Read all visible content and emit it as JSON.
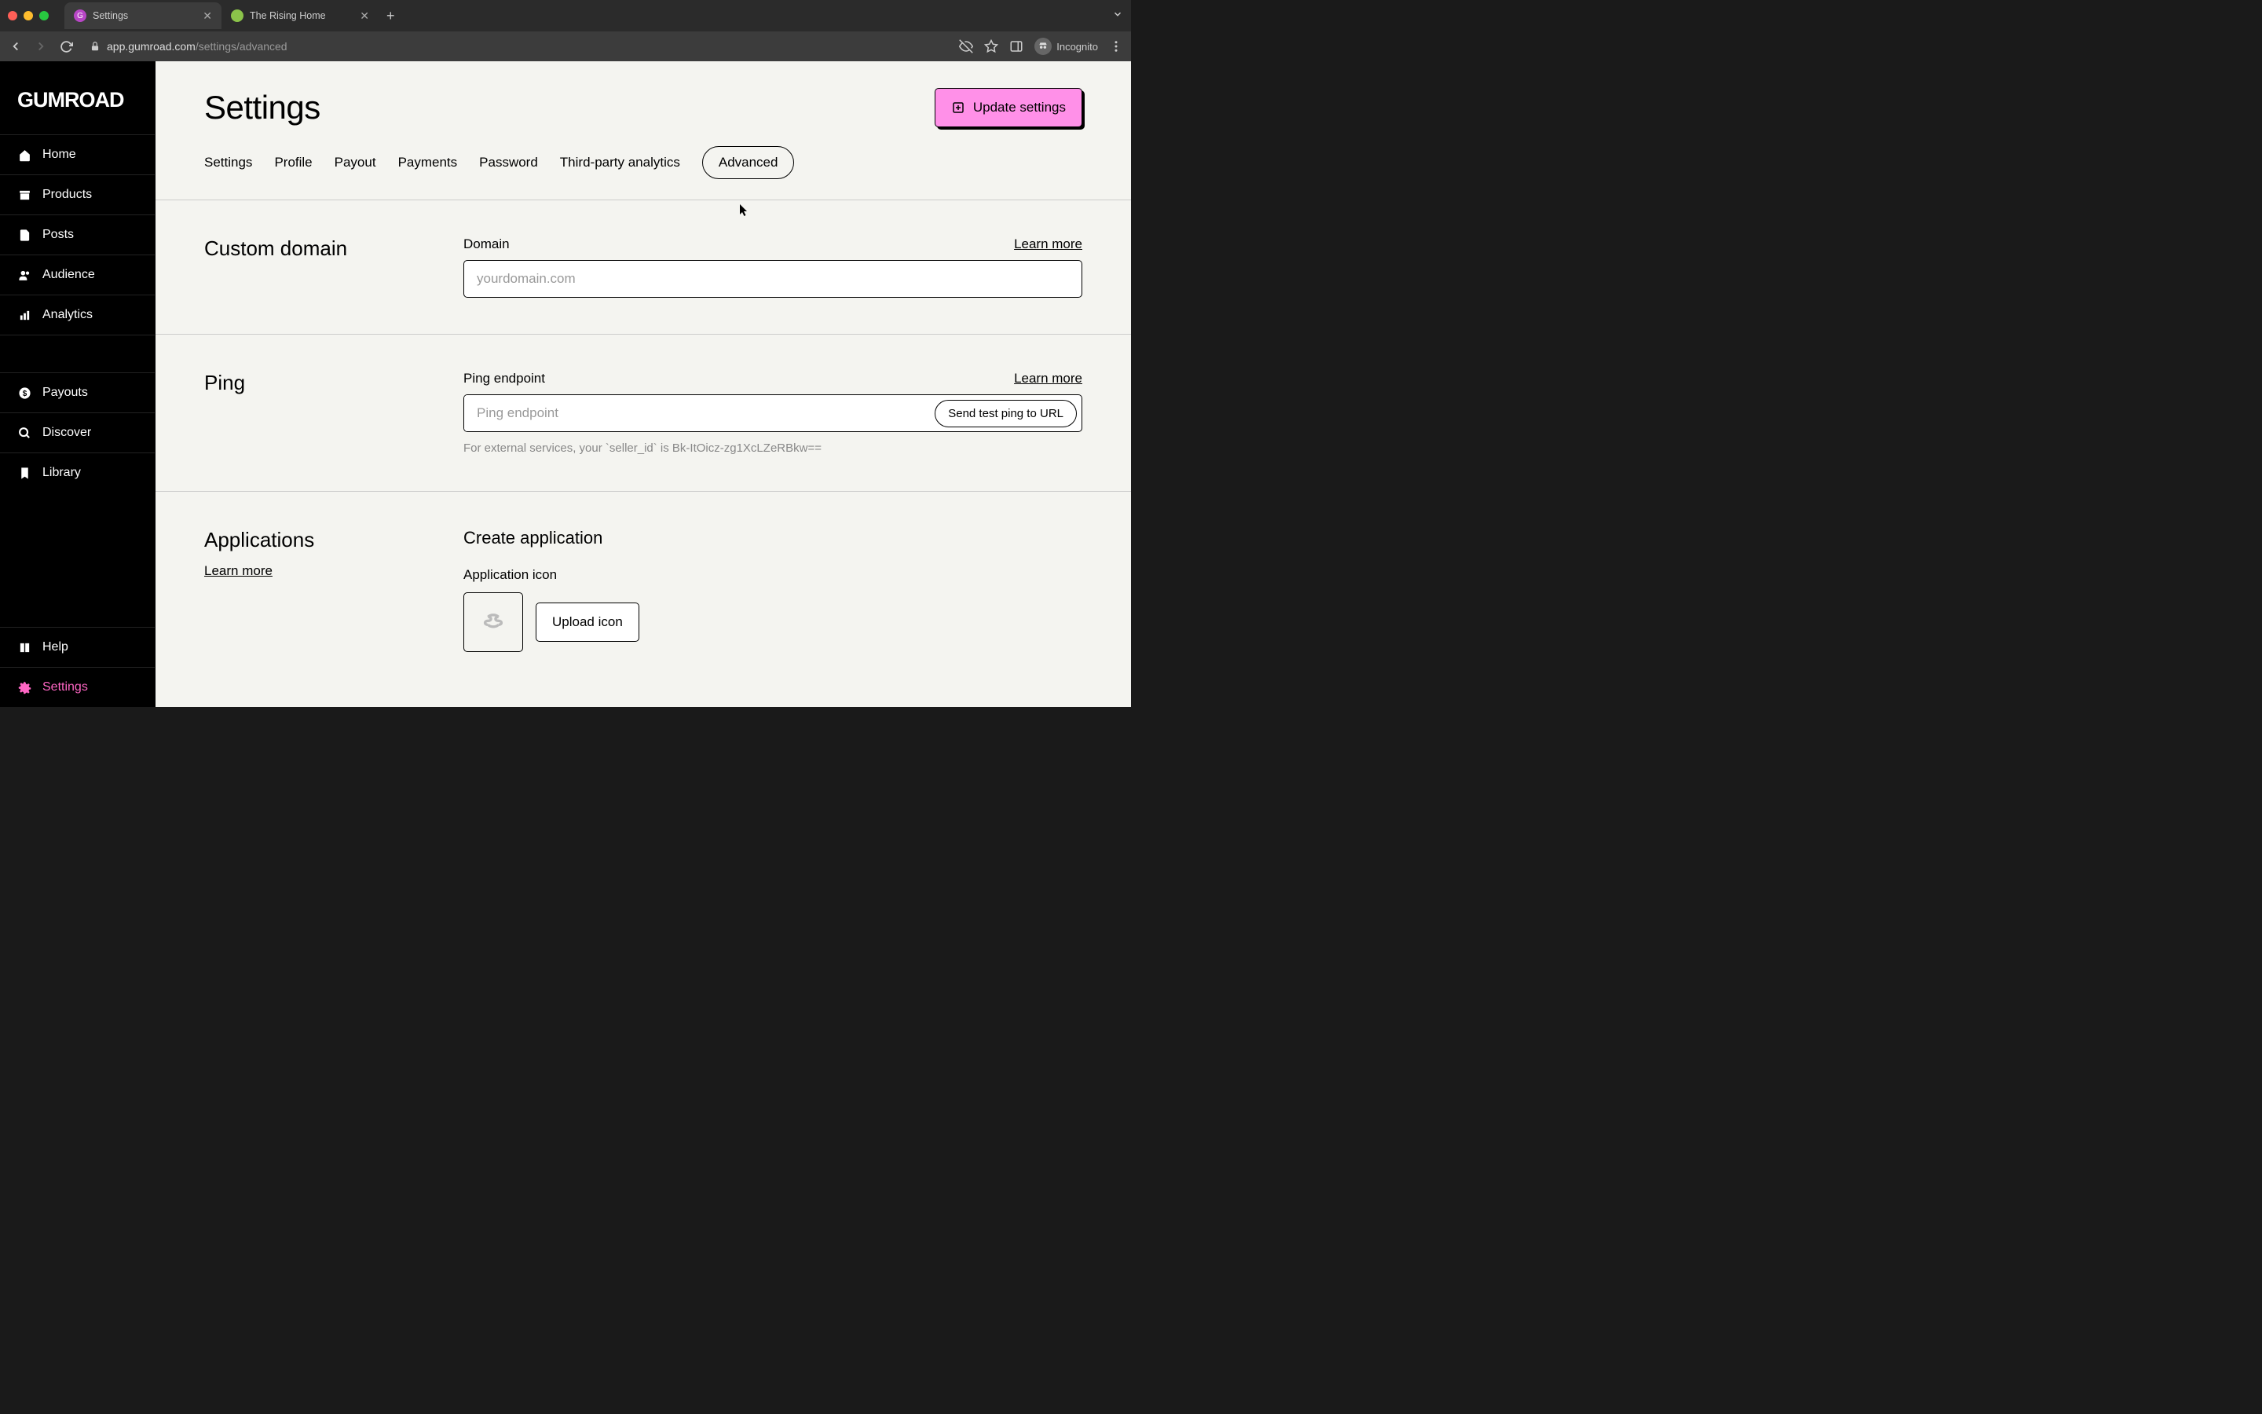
{
  "browser": {
    "tabs": [
      {
        "title": "Settings",
        "favicon_bg": "#b846c6"
      },
      {
        "title": "The Rising Home",
        "favicon_bg": "#8bc34a"
      }
    ],
    "url_host": "app.gumroad.com",
    "url_path": "/settings/advanced",
    "incognito": "Incognito"
  },
  "sidebar": {
    "logo": "GUMROAD",
    "items_top": [
      {
        "label": "Home",
        "icon": "home"
      },
      {
        "label": "Products",
        "icon": "archive"
      },
      {
        "label": "Posts",
        "icon": "file"
      },
      {
        "label": "Audience",
        "icon": "users"
      },
      {
        "label": "Analytics",
        "icon": "chart"
      }
    ],
    "items_mid": [
      {
        "label": "Payouts",
        "icon": "dollar"
      },
      {
        "label": "Discover",
        "icon": "search"
      },
      {
        "label": "Library",
        "icon": "bookmark"
      }
    ],
    "items_bot": [
      {
        "label": "Help",
        "icon": "book"
      },
      {
        "label": "Settings",
        "icon": "gear",
        "active": true
      }
    ]
  },
  "page": {
    "title": "Settings",
    "update_button": "Update settings",
    "tabs": [
      "Settings",
      "Profile",
      "Payout",
      "Payments",
      "Password",
      "Third-party analytics",
      "Advanced"
    ],
    "active_tab": 6
  },
  "custom_domain": {
    "title": "Custom domain",
    "label": "Domain",
    "learn_more": "Learn more",
    "placeholder": "yourdomain.com"
  },
  "ping": {
    "title": "Ping",
    "label": "Ping endpoint",
    "learn_more": "Learn more",
    "placeholder": "Ping endpoint",
    "button": "Send test ping to URL",
    "hint": "For external services, your `seller_id` is Bk-ItOicz-zg1XcLZeRBkw=="
  },
  "applications": {
    "title": "Applications",
    "learn_more": "Learn more",
    "create_heading": "Create application",
    "icon_label": "Application icon",
    "upload_button": "Upload icon"
  }
}
